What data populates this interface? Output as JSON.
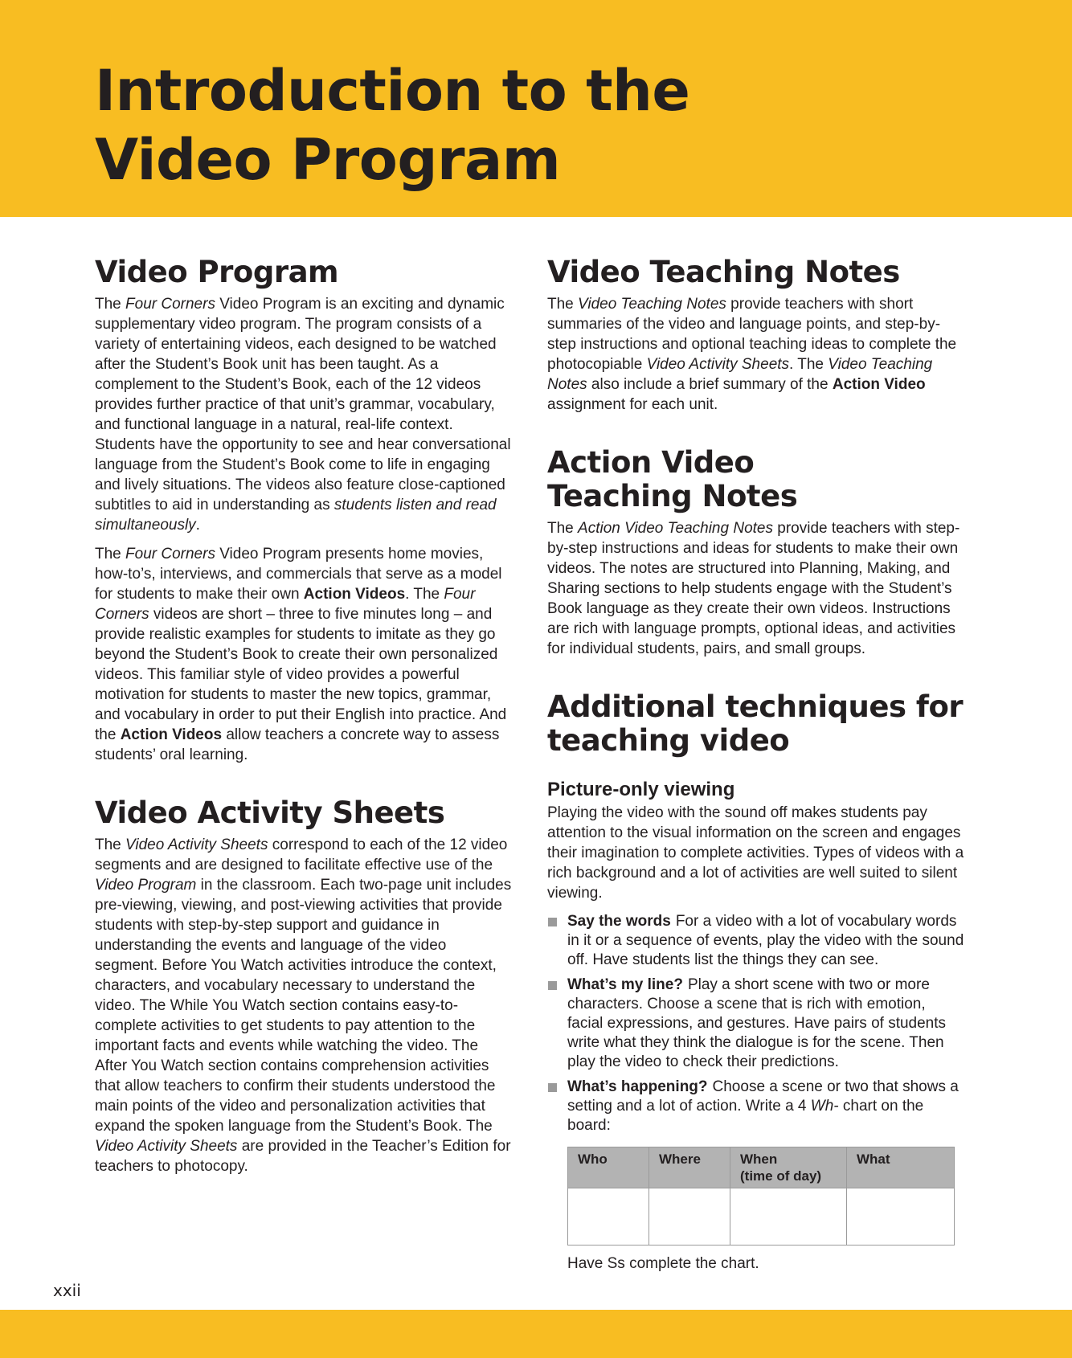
{
  "header": {
    "title_line1": "Introduction to the",
    "title_line2": "Video Program",
    "color": "#F8BD22"
  },
  "page_number": "xxii",
  "left": {
    "video_program": {
      "heading": "Video Program",
      "p1": [
        {
          "t": "The "
        },
        {
          "t": "Four Corners",
          "s": "i"
        },
        {
          "t": " Video Program is an exciting and dynamic supplementary video program. The program consists of a variety of entertaining videos, each designed to be watched after the Student’s Book unit has been taught. As a complement to the Student’s Book, each of the 12 videos provides further practice of that unit’s grammar, vocabulary, and functional language in a natural, real-life context. Students have the opportunity to see and hear conversational language from the Student’s Book come to life in engaging and lively situations. The videos also feature close-captioned subtitles to aid in understanding as "
        },
        {
          "t": "students listen and read simultaneously",
          "s": "i"
        },
        {
          "t": "."
        }
      ],
      "p2": [
        {
          "t": "The "
        },
        {
          "t": "Four Corners",
          "s": "i"
        },
        {
          "t": " Video Program presents home movies, how-to’s, interviews, and commercials that serve as a model for students to make their own "
        },
        {
          "t": "Action Videos",
          "s": "b"
        },
        {
          "t": ". The "
        },
        {
          "t": "Four Corners",
          "s": "i"
        },
        {
          "t": " videos are short – three to five minutes long – and provide realistic examples for students to imitate as they go beyond the Student’s Book to create their own personalized videos. This familiar style of video provides a powerful motivation for students to master the new topics, grammar, and vocabulary in order to put their English into practice. And the "
        },
        {
          "t": "Action Videos",
          "s": "b"
        },
        {
          "t": " allow teachers a concrete way to assess students’ oral learning."
        }
      ]
    },
    "activity_sheets": {
      "heading": "Video Activity Sheets",
      "p1": [
        {
          "t": "The "
        },
        {
          "t": "Video Activity Sheets",
          "s": "i"
        },
        {
          "t": " correspond to each of the 12 video segments and are designed to facilitate effective use of the "
        },
        {
          "t": "Video Program",
          "s": "i"
        },
        {
          "t": " in the classroom. Each two-page unit includes pre-viewing, viewing, and post-viewing activities that provide students with step-by-step support and guidance in understanding the events and language of the video segment. Before You Watch activities introduce the context, characters, and vocabulary necessary to understand the video. The While You Watch section contains easy-to-complete activities to get students to pay attention to the important facts and events while watching the video. The After You Watch section contains comprehension activities that allow teachers to confirm their students understood the main points of the video and personalization activities that expand the spoken language from the Student’s Book. The "
        },
        {
          "t": "Video Activity Sheets",
          "s": "i"
        },
        {
          "t": " are provided in the Teacher’s Edition for teachers to photocopy."
        }
      ]
    }
  },
  "right": {
    "teaching_notes": {
      "heading": "Video Teaching Notes",
      "p1": [
        {
          "t": "The "
        },
        {
          "t": "Video Teaching Notes",
          "s": "i"
        },
        {
          "t": " provide teachers with short summaries of the video and language points, and step-by-step instructions and optional teaching ideas to complete the photocopiable "
        },
        {
          "t": "Video Activity Sheets",
          "s": "i"
        },
        {
          "t": ". The "
        },
        {
          "t": "Video Teaching Notes",
          "s": "i"
        },
        {
          "t": " also include a brief summary of the "
        },
        {
          "t": "Action Video",
          "s": "b"
        },
        {
          "t": " assignment for each unit."
        }
      ]
    },
    "action_notes": {
      "heading_line1": "Action Video",
      "heading_line2": "Teaching Notes",
      "p1": [
        {
          "t": "The "
        },
        {
          "t": "Action Video Teaching Notes",
          "s": "i"
        },
        {
          "t": " provide teachers with step-by-step instructions and ideas for students to make their own videos. The notes are structured into Planning, Making, and Sharing sections to help students engage with the Student’s Book language as they create their own videos. Instructions are rich with language prompts, optional ideas, and activities for individual students, pairs, and small groups."
        }
      ]
    },
    "techniques": {
      "heading_line1": "Additional techniques for",
      "heading_line2": "teaching video",
      "subheading": "Picture-only viewing",
      "intro": "Playing the video with the sound off makes students pay attention to the visual information on the screen and engages their imagination to complete activities. Types of videos with a rich background and a lot of activities are well suited to silent viewing.",
      "bullets": [
        {
          "label": "Say the words",
          "text": [
            {
              "t": "For a video with a lot of vocabulary words in it or a sequence of events, play the video with the sound off. Have students list the things they can see."
            }
          ]
        },
        {
          "label": "What’s my line?",
          "text": [
            {
              "t": "Play a short scene with two or more characters. Choose a scene that is rich with emotion, facial expressions, and gestures. Have pairs of students write what they think the dialogue is for the scene. Then play the video to check their predictions."
            }
          ]
        },
        {
          "label": "What’s happening?",
          "text": [
            {
              "t": "Choose a scene or two that shows a setting and a lot of action. Write a 4 "
            },
            {
              "t": "Wh-",
              "s": "i"
            },
            {
              "t": " chart on the board:"
            }
          ]
        }
      ],
      "table_headers": [
        "Who",
        "Where",
        "When\n(time of day)",
        "What"
      ],
      "after_table": "Have Ss complete the chart."
    }
  }
}
